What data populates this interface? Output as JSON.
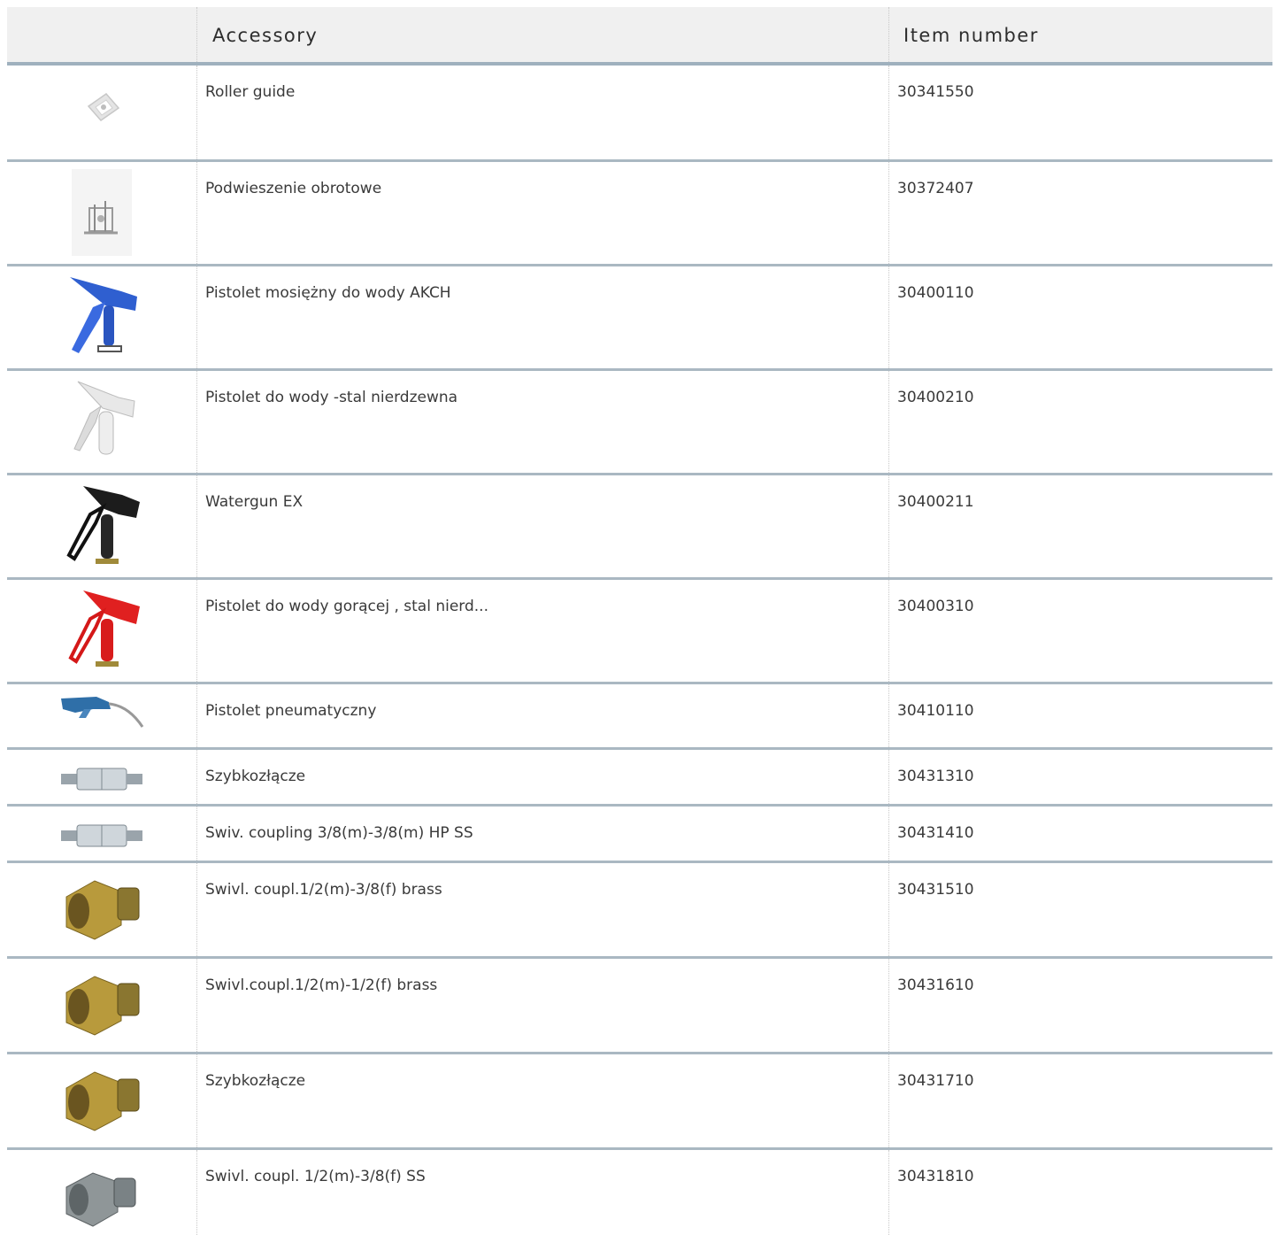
{
  "table": {
    "headers": {
      "image": "",
      "accessory": "Accessory",
      "item_number": "Item number"
    },
    "rows": [
      {
        "name": "Roller guide",
        "number": "30341550",
        "icon": "roller-guide-icon"
      },
      {
        "name": "Podwieszenie obrotowe",
        "number": "30372407",
        "icon": "swivel-suspension-icon"
      },
      {
        "name": "Pistolet mosiężny do wody AKCH",
        "number": "30400110",
        "icon": "blue-water-gun-icon"
      },
      {
        "name": "Pistolet do wody -stal nierdzewna",
        "number": "30400210",
        "icon": "white-water-gun-icon"
      },
      {
        "name": "Watergun EX",
        "number": "30400211",
        "icon": "black-water-gun-icon"
      },
      {
        "name": "Pistolet do wody gorącej , stal nierd...",
        "number": "30400310",
        "icon": "red-water-gun-icon"
      },
      {
        "name": "Pistolet pneumatyczny",
        "number": "30410110",
        "icon": "air-gun-icon"
      },
      {
        "name": "Szybkozłącze",
        "number": "30431310",
        "icon": "steel-coupling-icon"
      },
      {
        "name": "Swiv. coupling 3/8(m)-3/8(m) HP SS",
        "number": "30431410",
        "icon": "steel-coupling-icon"
      },
      {
        "name": "Swivl. coupl.1/2(m)-3/8(f) brass",
        "number": "30431510",
        "icon": "brass-fitting-icon"
      },
      {
        "name": "Swivl.coupl.1/2(m)-1/2(f) brass",
        "number": "30431610",
        "icon": "brass-fitting-icon"
      },
      {
        "name": "Szybkozłącze",
        "number": "30431710",
        "icon": "brass-fitting-icon"
      },
      {
        "name": "Swivl. coupl. 1/2(m)-3/8(f) SS",
        "number": "30431810",
        "icon": "steel-fitting-icon"
      }
    ]
  }
}
